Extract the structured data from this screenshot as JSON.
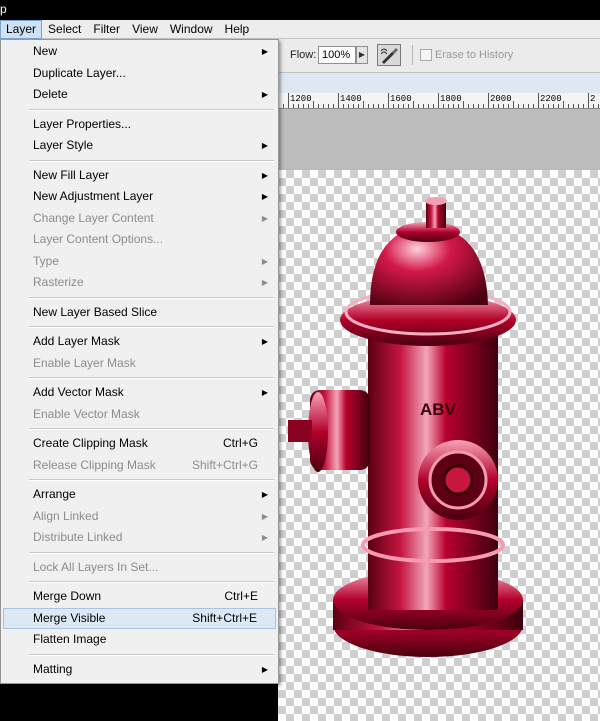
{
  "menubar": {
    "items": [
      "Layer",
      "Select",
      "Filter",
      "View",
      "Window",
      "Help"
    ],
    "active": "Layer"
  },
  "options_bar": {
    "flow_label": "Flow:",
    "flow_value": "100%",
    "erase_to_history": "Erase to History",
    "erase_to_history_checked": false
  },
  "ruler": {
    "labels": [
      "1200",
      "1400",
      "1600",
      "1800",
      "2000",
      "2200",
      "2"
    ]
  },
  "menu": {
    "items": [
      {
        "label": "New",
        "submenu": true
      },
      {
        "label": "Duplicate Layer..."
      },
      {
        "label": "Delete",
        "submenu": true
      },
      {
        "label": "Layer Properties..."
      },
      {
        "label": "Layer Style",
        "submenu": true
      },
      {
        "label": "New Fill Layer",
        "submenu": true
      },
      {
        "label": "New Adjustment Layer",
        "submenu": true
      },
      {
        "label": "Change Layer Content",
        "submenu": true,
        "disabled": true
      },
      {
        "label": "Layer Content Options...",
        "disabled": true
      },
      {
        "label": "Type",
        "submenu": true,
        "disabled": true
      },
      {
        "label": "Rasterize",
        "submenu": true,
        "disabled": true
      },
      {
        "label": "New Layer Based Slice"
      },
      {
        "label": "Add Layer Mask",
        "submenu": true
      },
      {
        "label": "Enable Layer Mask",
        "disabled": true
      },
      {
        "label": "Add Vector Mask",
        "submenu": true
      },
      {
        "label": "Enable Vector Mask",
        "disabled": true
      },
      {
        "label": "Create Clipping Mask",
        "shortcut": "Ctrl+G"
      },
      {
        "label": "Release Clipping Mask",
        "shortcut": "Shift+Ctrl+G",
        "disabled": true
      },
      {
        "label": "Arrange",
        "submenu": true
      },
      {
        "label": "Align Linked",
        "submenu": true,
        "disabled": true
      },
      {
        "label": "Distribute Linked",
        "submenu": true,
        "disabled": true
      },
      {
        "label": "Lock All Layers In Set...",
        "disabled": true
      },
      {
        "label": "Merge Down",
        "shortcut": "Ctrl+E"
      },
      {
        "label": "Merge Visible",
        "shortcut": "Shift+Ctrl+E",
        "highlighted": true
      },
      {
        "label": "Flatten Image"
      },
      {
        "label": "Matting",
        "submenu": true
      }
    ]
  },
  "canvas": {
    "hydrant_text": "ABV"
  },
  "colors": {
    "menu_highlight": "#dde8f5",
    "hydrant_red": "#b0002e",
    "disabled_text": "#8c8c8c"
  }
}
